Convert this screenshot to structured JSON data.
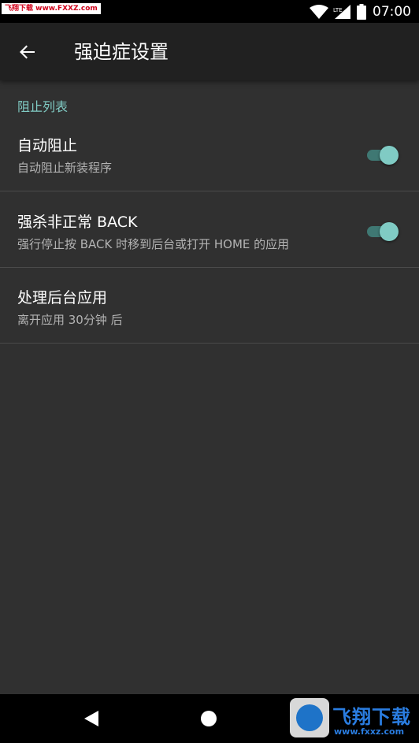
{
  "status_bar": {
    "watermark": "飞翔下载 www.FXXZ.com",
    "network_label": "LTE",
    "time": "07:00",
    "icons": [
      "wifi-icon",
      "cell-signal-icon",
      "battery-icon"
    ]
  },
  "app_bar": {
    "title": "强迫症设置",
    "back_icon": "arrow-back-icon"
  },
  "section": {
    "header": "阻止列表"
  },
  "preferences": [
    {
      "title": "自动阻止",
      "summary": "自动阻止新装程序",
      "toggle": true
    },
    {
      "title": "强杀非正常 BACK",
      "summary": "强行停止按 BACK 时移到后台或打开 HOME 的应用",
      "toggle": true
    },
    {
      "title": "处理后台应用",
      "summary": "离开应用 30分钟 后"
    }
  ],
  "watermark_logo": {
    "brand": "飞翔下载",
    "url": "www.fxxz.com"
  },
  "colors": {
    "background": "#303030",
    "app_bar": "#212121",
    "accent": "#80cbc4",
    "accent_track": "#3f7873",
    "divider": "#4a4a4a"
  }
}
